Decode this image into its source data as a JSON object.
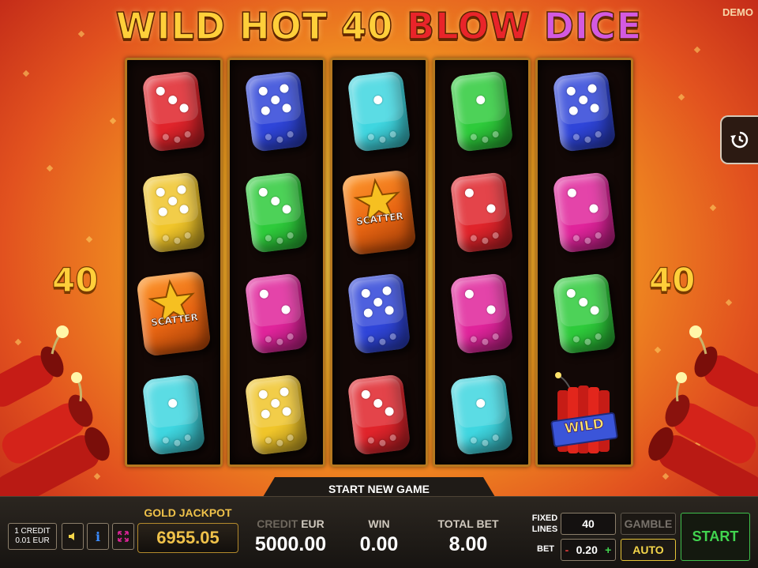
{
  "header": {
    "title_part1": "WILD HOT 40",
    "title_part2": "BLOW",
    "title_part3": "DICE",
    "mode_badge": "DEMO"
  },
  "side_lines": {
    "left": "40",
    "right": "40"
  },
  "reels": [
    [
      {
        "type": "die",
        "color": "#e0242b",
        "pips": 3
      },
      {
        "type": "die",
        "color": "#f0c52a",
        "pips": 5
      },
      {
        "type": "scatter",
        "label": "SCATTER"
      },
      {
        "type": "die",
        "color": "#3fd6e0",
        "pips": 1
      }
    ],
    [
      {
        "type": "die",
        "color": "#2f45d9",
        "pips": 5
      },
      {
        "type": "die",
        "color": "#2ecb3b",
        "pips": 3
      },
      {
        "type": "die",
        "color": "#e0249b",
        "pips": 2
      },
      {
        "type": "die",
        "color": "#f0c52a",
        "pips": 5
      }
    ],
    [
      {
        "type": "die",
        "color": "#3fd6e0",
        "pips": 1
      },
      {
        "type": "scatter",
        "label": "SCATTER"
      },
      {
        "type": "die",
        "color": "#2f45d9",
        "pips": 5
      },
      {
        "type": "die",
        "color": "#e0242b",
        "pips": 3
      }
    ],
    [
      {
        "type": "die",
        "color": "#2ecb3b",
        "pips": 1
      },
      {
        "type": "die",
        "color": "#e0242b",
        "pips": 2
      },
      {
        "type": "die",
        "color": "#e0249b",
        "pips": 2
      },
      {
        "type": "die",
        "color": "#3fd6e0",
        "pips": 1
      }
    ],
    [
      {
        "type": "die",
        "color": "#2f45d9",
        "pips": 5
      },
      {
        "type": "die",
        "color": "#e0249b",
        "pips": 2
      },
      {
        "type": "die",
        "color": "#2ecb3b",
        "pips": 3
      },
      {
        "type": "wild",
        "label": "WILD"
      }
    ]
  ],
  "history_button_icon": "history-icon",
  "bottom_bar": {
    "start_new_game": "START NEW GAME",
    "credit_denomination": {
      "line1": "1 CREDIT",
      "line2": "0.01 EUR"
    },
    "icons": [
      "sound-icon",
      "info-icon",
      "fullscreen-icon"
    ],
    "jackpot": {
      "label": "GOLD JACKPOT",
      "value": "6955.05"
    },
    "credit": {
      "label_dim": "CREDIT",
      "label_currency": "EUR",
      "value": "5000.00"
    },
    "win": {
      "label": "WIN",
      "value": "0.00"
    },
    "total_bet": {
      "label": "TOTAL BET",
      "value": "8.00"
    },
    "fixed_lines": {
      "label_line1": "FIXED",
      "label_line2": "LINES",
      "value": "40"
    },
    "bet": {
      "label": "BET",
      "minus": "-",
      "value": "0.20",
      "plus": "+"
    },
    "gamble": "GAMBLE",
    "auto": "AUTO",
    "start": "START"
  },
  "colors": {
    "gold": "#f0c24a",
    "start_green": "#41d44f",
    "auto_yellow": "#f5d64a"
  }
}
